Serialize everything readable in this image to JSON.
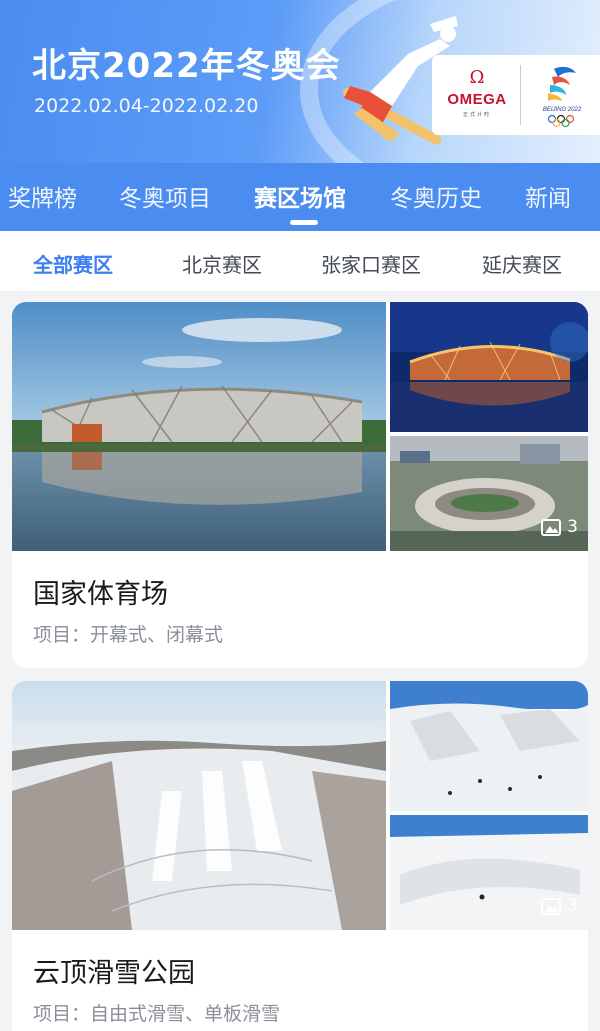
{
  "header": {
    "title": "北京2022年冬奥会",
    "dates": "2022.02.04-2022.02.20",
    "sponsor": {
      "omega_symbol": "Ω",
      "omega_name": "OMEGA",
      "omega_sub": "正式计时",
      "beijing_text": "BEIJING 2022"
    }
  },
  "main_tabs": [
    "奖牌榜",
    "冬奥项目",
    "赛区场馆",
    "冬奥历史",
    "新闻"
  ],
  "main_tab_active": "赛区场馆",
  "sub_tabs": [
    "全部赛区",
    "北京赛区",
    "张家口赛区",
    "延庆赛区"
  ],
  "sub_tab_active": "全部赛区",
  "venues": [
    {
      "name": "国家体育场",
      "events_label": "项目：",
      "events": "开幕式、闭幕式",
      "photo_count": "3"
    },
    {
      "name": "云顶滑雪公园",
      "events_label": "项目：",
      "events": "自由式滑雪、单板滑雪",
      "photo_count": "3"
    }
  ],
  "colors": {
    "brand_blue": "#4a8cf0",
    "active_sub_tab": "#3d7ef0",
    "omega_red": "#c8102e"
  }
}
